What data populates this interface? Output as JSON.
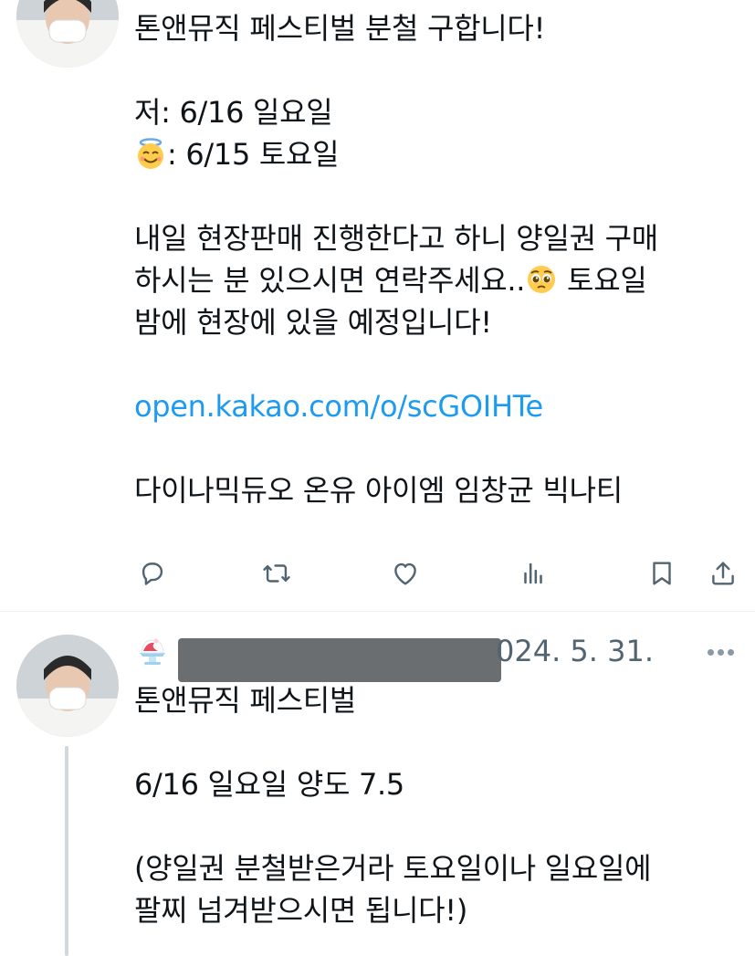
{
  "tweet1": {
    "lines": {
      "l1": "톤앤뮤직 페스티벌 분철 구합니다!",
      "l2": "저: 6/16 일요일",
      "l3_after_emoji": ": 6/15 토요일",
      "l4": "내일 현장판매 진행한다고 하니 양일권 구매",
      "l5a": "하시는 분 있으시면 연락주세요..",
      "l5b": " 토요일",
      "l6": "밤에 현장에 있을 예정입니다!",
      "link": "open.kakao.com/o/scGOIHTe",
      "l8": "다이나믹듀오 온유 아이엠 임창균 빅나티"
    },
    "emojis": [
      "smiling-face-with-halo",
      "pleading-face"
    ],
    "actions": [
      "reply",
      "retweet",
      "like",
      "views",
      "bookmark",
      "share"
    ]
  },
  "tweet2": {
    "header": {
      "emoji": "shaved-ice",
      "date": "024. 5. 31."
    },
    "lines": {
      "l1": "톤앤뮤직 페스티벌",
      "l2": "6/16 일요일 양도 7.5",
      "l3": "(양일권 분철받은거라 토요일이나 일요일에",
      "l4": "팔찌 넘겨받으시면 됩니다!)"
    }
  },
  "colors": {
    "link": "#1d9bf0",
    "text": "#0f1419",
    "secondary": "#536471",
    "icon": "#536471",
    "divider": "#eff3f4",
    "thread_line": "#cfd9de"
  }
}
